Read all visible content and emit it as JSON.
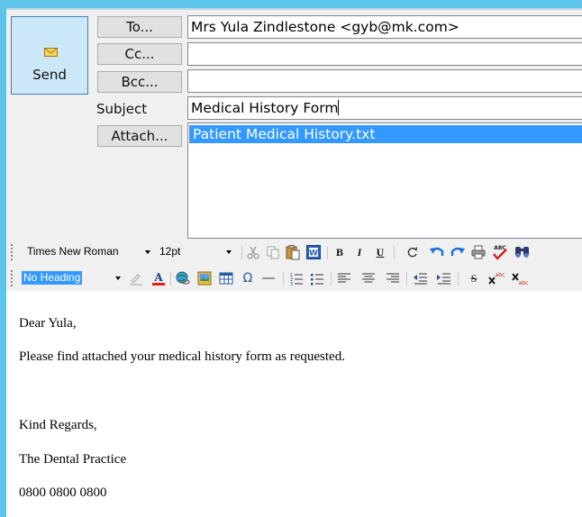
{
  "compose": {
    "send_label": "Send",
    "to_label": "To...",
    "cc_label": "Cc...",
    "bcc_label": "Bcc...",
    "subject_label": "Subject",
    "attach_label": "Attach...",
    "to_value": "Mrs Yula Zindlestone <gyb@mk.com>",
    "cc_value": "",
    "bcc_value": "",
    "subject_value": "Medical History Form",
    "attachments": [
      "Patient Medical History.txt"
    ]
  },
  "toolbar": {
    "font_name": "Times New Roman",
    "font_size": "12pt",
    "heading": "No Heading",
    "bold_label": "B",
    "italic_label": "I",
    "underline_label": "U",
    "strike_label": "S",
    "omega_label": "Ω",
    "icons": [
      "cut-icon",
      "copy-icon",
      "paste-icon",
      "paste-word-icon",
      "bold-icon",
      "italic-icon",
      "underline-icon",
      "clear-icon",
      "undo-icon",
      "redo-icon",
      "print-icon",
      "spellcheck-icon",
      "find-icon",
      "highlight-icon",
      "font-color-icon",
      "link-icon",
      "image-icon",
      "table-icon",
      "special-char-icon",
      "horizontal-rule-icon",
      "numbered-list-icon",
      "bullet-list-icon",
      "align-left-icon",
      "align-center-icon",
      "align-right-icon",
      "outdent-icon",
      "indent-icon",
      "strikethrough-icon",
      "superscript-icon",
      "subscript-icon"
    ]
  },
  "body": {
    "lines": [
      "Dear Yula,",
      "Please find attached your medical history form as requested.",
      "Kind Regards,",
      "The Dental Practice",
      "0800 0800 0800"
    ]
  },
  "colors": {
    "desktop": "#5fc4ea",
    "send_button": "#cce8f8",
    "selection": "#3399ff",
    "undo_blue": "#1e6fd6",
    "spell_red": "#d02020",
    "font_color_red": "#e02020"
  }
}
